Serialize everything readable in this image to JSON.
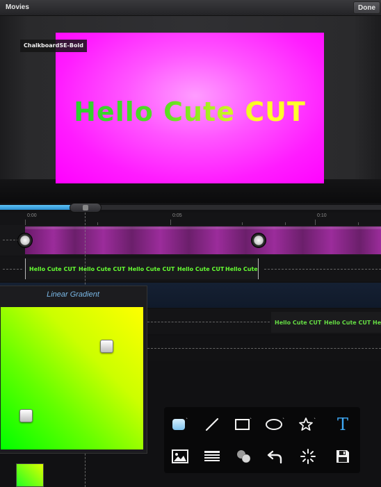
{
  "topbar": {
    "movies_label": "Movies",
    "done_label": "Done"
  },
  "preview": {
    "font_badge": "ChalkboardSE-Bold",
    "screen_text": "Hello Cute CUT",
    "screen_color": "#ff00ff"
  },
  "timeline": {
    "ruler_labels": [
      "0:00",
      "0:05",
      "0:10"
    ],
    "title_clip_texts": [
      "Hello Cute CUT",
      "Hello Cute CUT",
      "Hello Cute CUT",
      "Hello Cute CUT",
      "Hello Cute"
    ],
    "title_clip2_texts": [
      "Hello Cute CUT",
      "Hello Cute CUT",
      "Hello"
    ]
  },
  "gradient_panel": {
    "title": "Linear Gradient",
    "start_color": "#00ff00",
    "end_color": "#ffff00"
  },
  "toolbar": {
    "row1": [
      "rounded-rect-tool-icon",
      "line-tool-icon",
      "rectangle-tool-icon",
      "ellipse-tool-icon",
      "star-tool-icon",
      "text-tool-icon"
    ],
    "row2": [
      "image-tool-icon",
      "lines-tool-icon",
      "layers-icon",
      "undo-icon",
      "effects-icon",
      "save-icon"
    ],
    "text_tool_label": "T"
  },
  "colors": {
    "accent": "#2a8fd0",
    "title_green": "#66ff33",
    "link_blue": "#7ab8e6"
  }
}
